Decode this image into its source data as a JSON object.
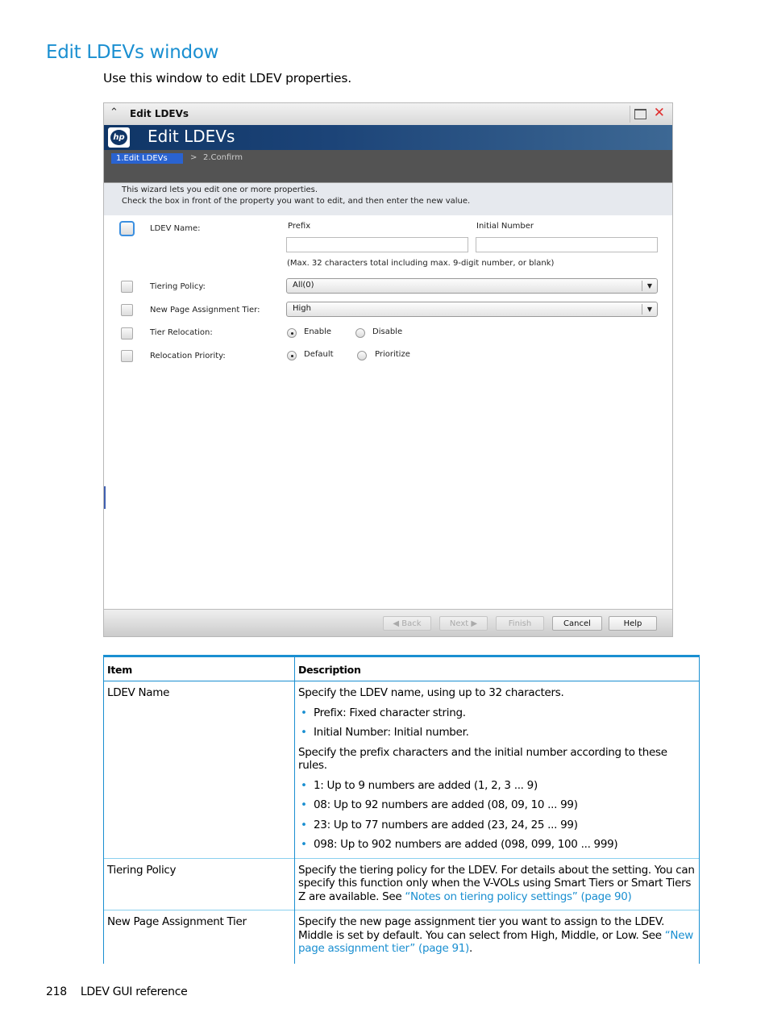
{
  "section": {
    "title": "Edit LDEVs window",
    "intro": "Use this window to edit LDEV properties."
  },
  "window": {
    "titlebar_title": "Edit LDEVs",
    "banner_title": "Edit LDEVs",
    "logo_text": "hp",
    "icons": {
      "collapse": "double-chevron-up-icon",
      "maximize": "maximize-icon",
      "close": "close-icon"
    },
    "steps": [
      {
        "label": "1.Edit LDEVs",
        "active": true
      },
      {
        "label": "2.Confirm",
        "active": false
      }
    ],
    "step_separator": ">",
    "info_lines": [
      "This wizard lets you edit one or more properties.",
      "Check the  box in front of the property you want to edit, and then enter the new value."
    ],
    "ldev_name": {
      "label": "LDEV Name:",
      "prefix_label": "Prefix",
      "prefix_value": "",
      "initial_number_label": "Initial Number",
      "initial_number_value": "",
      "hint": "(Max. 32 characters total including max. 9-digit number, or blank)",
      "checked": false
    },
    "tiering_policy": {
      "label": "Tiering Policy:",
      "selected": "All(0)",
      "checked": false
    },
    "new_page_tier": {
      "label": "New Page Assignment Tier:",
      "selected": "High",
      "checked": false
    },
    "tier_relocation": {
      "label": "Tier Relocation:",
      "options": [
        "Enable",
        "Disable"
      ],
      "selected": "Enable",
      "checked": false
    },
    "relocation_priority": {
      "label": "Relocation Priority:",
      "options": [
        "Default",
        "Prioritize"
      ],
      "selected": "Default",
      "checked": false
    },
    "buttons": {
      "back": "Back",
      "next": "Next",
      "finish": "Finish",
      "cancel": "Cancel",
      "help": "Help"
    }
  },
  "table": {
    "headers": [
      "Item",
      "Description"
    ],
    "rows": [
      {
        "item": "LDEV Name",
        "intro": "Specify the LDEV name, using up to 32 characters.",
        "bullets1": [
          "Prefix: Fixed character string.",
          "Initial Number: Initial number."
        ],
        "middle": "Specify the prefix characters and the initial number according to these rules.",
        "bullets2": [
          "1: Up to 9 numbers are added (1, 2, 3 ... 9)",
          "08: Up to 92 numbers are added (08, 09, 10 ... 99)",
          "23: Up to 77 numbers are added (23, 24, 25 ... 99)",
          "098: Up to 902 numbers are added (098, 099, 100 ... 999)"
        ]
      },
      {
        "item": "Tiering Policy",
        "text": "Specify the tiering policy for the LDEV. For details about the setting. You can specify this function only when the V-VOLs using Smart Tiers or Smart Tiers Z are available. See ",
        "link": "“Notes on tiering policy settings” (page 90)"
      },
      {
        "item": "New Page Assignment Tier",
        "text": "Specify the new page assignment tier you want to assign to the LDEV. Middle is set by default. You can select from High, Middle, or Low. See ",
        "link": "“New page assignment tier” (page 91)",
        "after": "."
      }
    ]
  },
  "footer": {
    "page_number": "218",
    "section": "LDEV GUI reference"
  }
}
